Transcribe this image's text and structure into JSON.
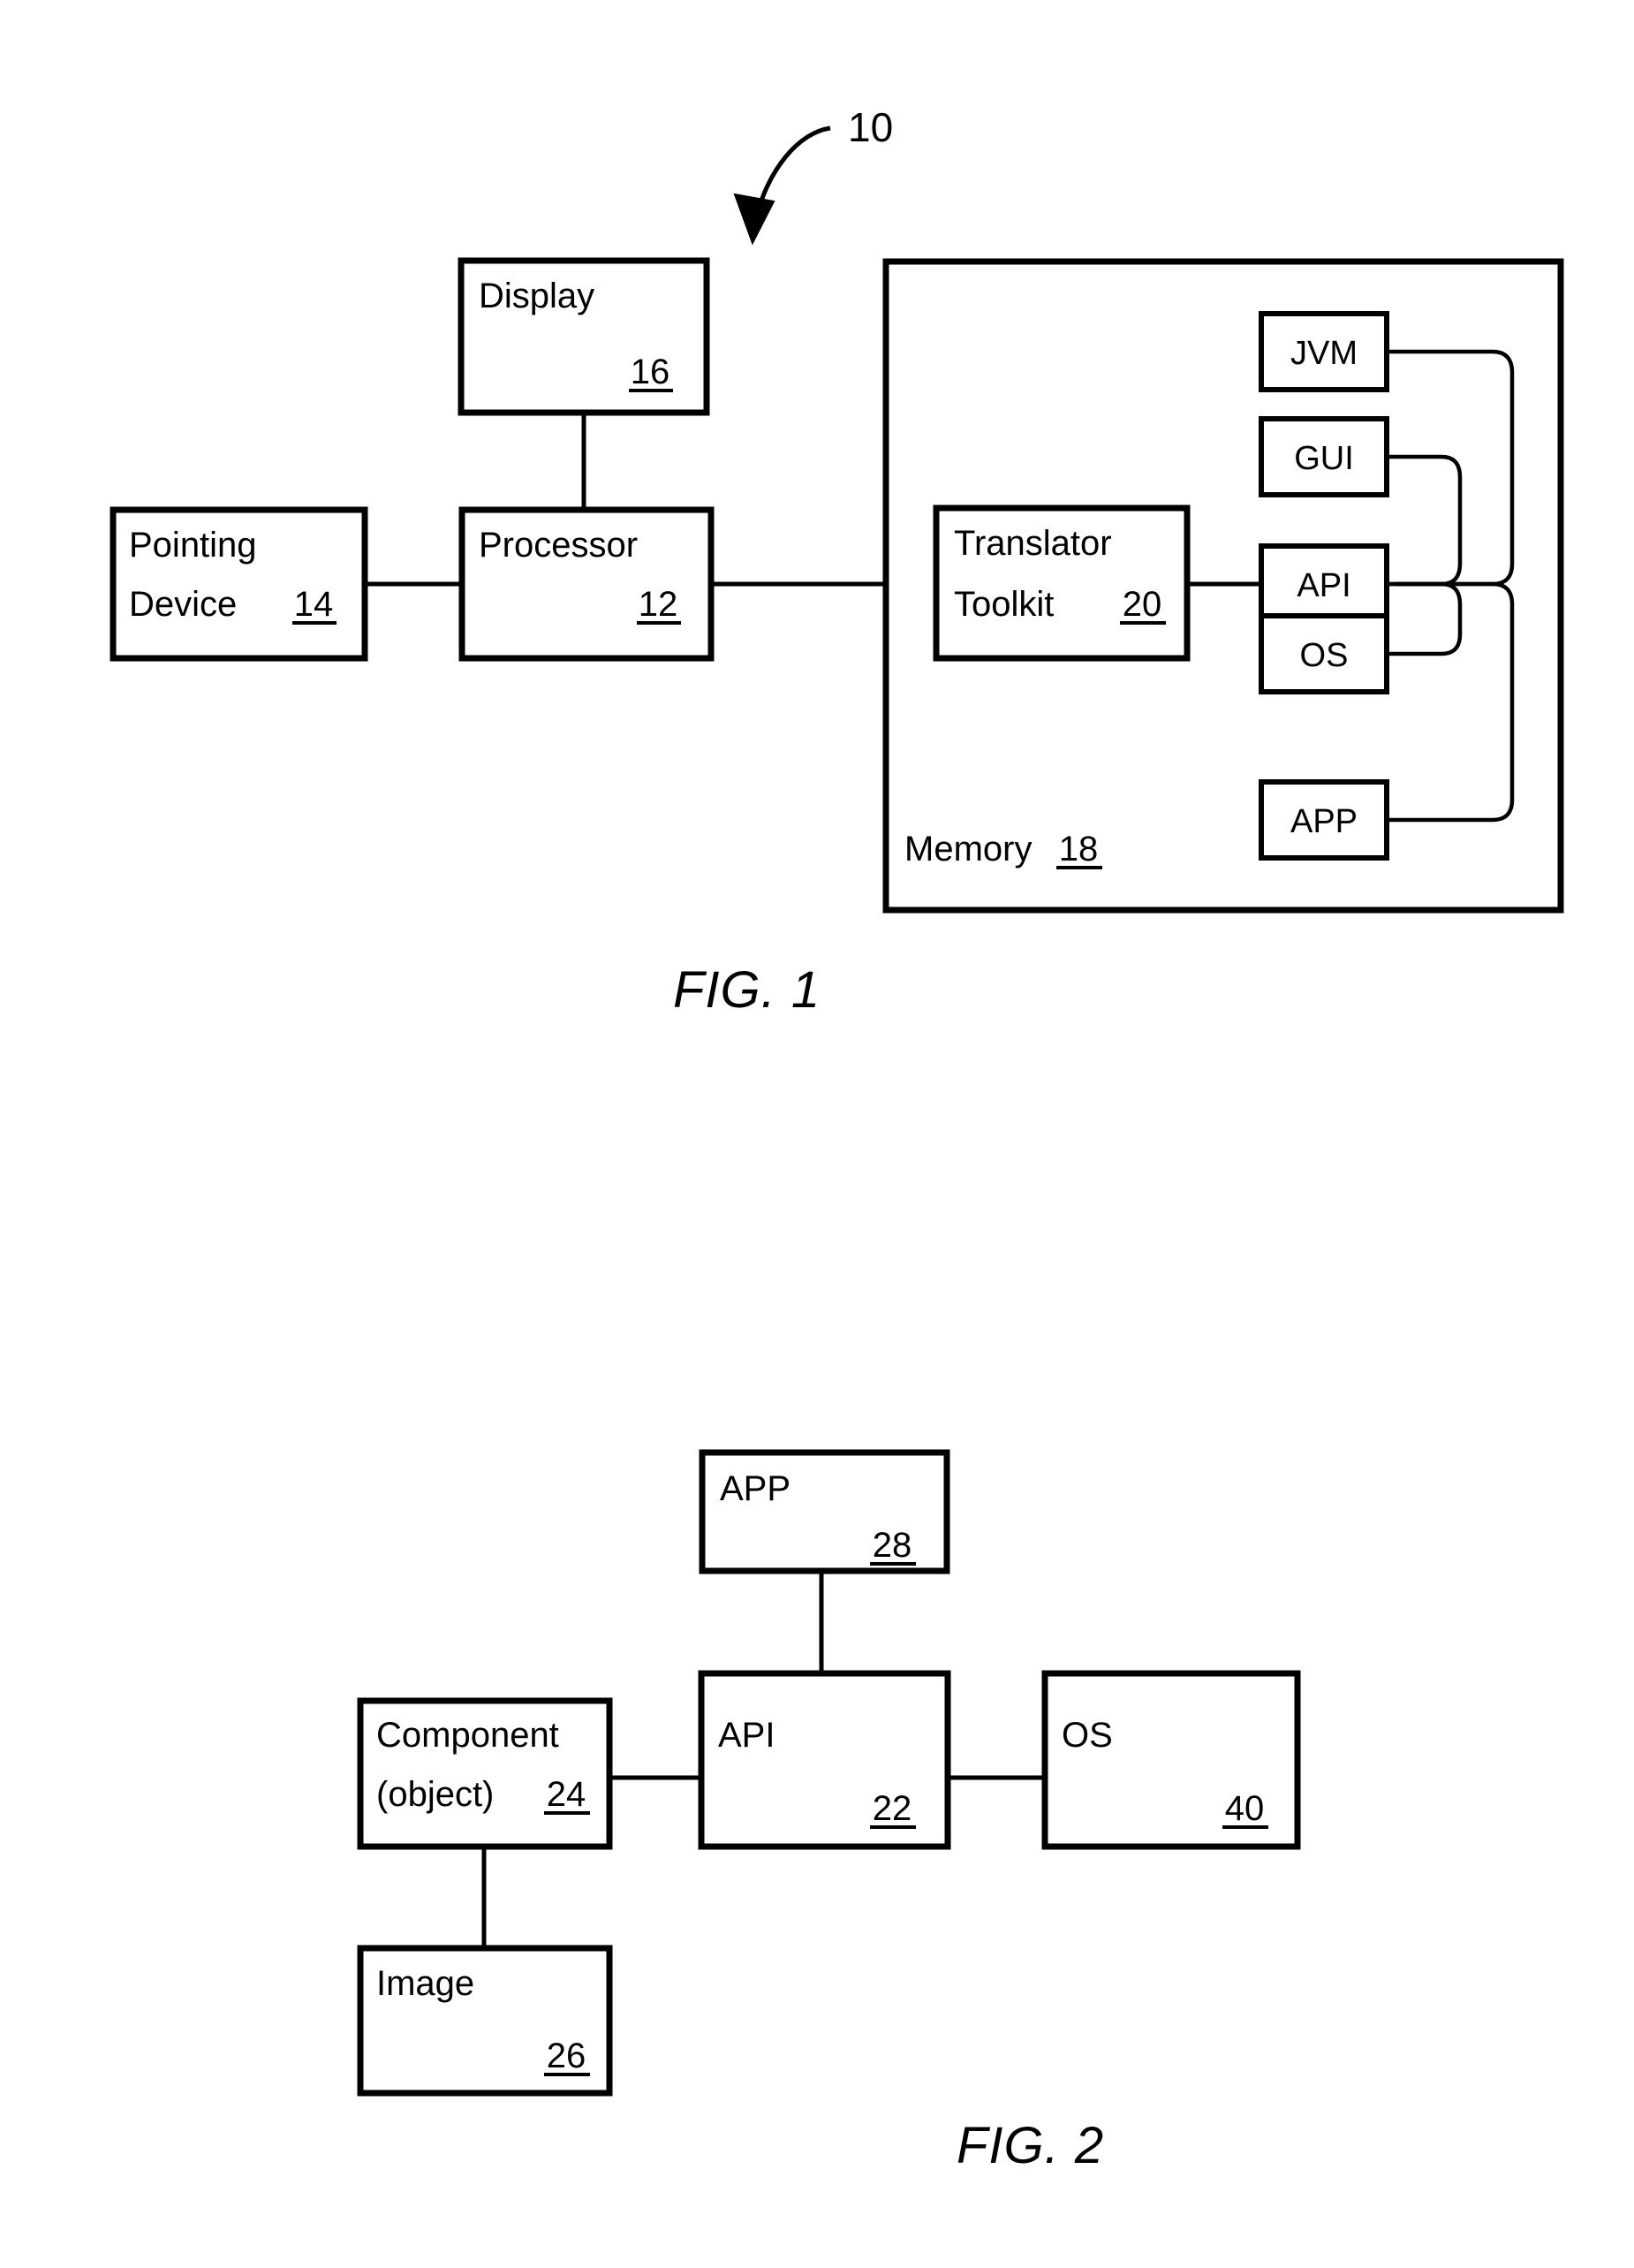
{
  "document": {
    "type": "patent-drawing-sheet",
    "figures": [
      {
        "id": "fig1",
        "caption": "FIG. 1",
        "reference_tag": "10",
        "blocks": [
          {
            "key": "display",
            "label": "Display",
            "number": "16"
          },
          {
            "key": "pointing",
            "label_line1": "Pointing",
            "label_line2": "Device",
            "number": "14"
          },
          {
            "key": "processor",
            "label": "Processor",
            "number": "12"
          },
          {
            "key": "memory",
            "label": "Memory",
            "number": "18"
          },
          {
            "key": "translator",
            "label_line1": "Translator",
            "label_line2": "Toolkit",
            "number": "20"
          },
          {
            "key": "jvm",
            "label": "JVM",
            "number": ""
          },
          {
            "key": "gui",
            "label": "GUI",
            "number": ""
          },
          {
            "key": "api",
            "label": "API",
            "number": ""
          },
          {
            "key": "os",
            "label": "OS",
            "number": ""
          },
          {
            "key": "app",
            "label": "APP",
            "number": ""
          }
        ]
      },
      {
        "id": "fig2",
        "caption": "FIG. 2",
        "blocks": [
          {
            "key": "app2",
            "label": "APP",
            "number": "28"
          },
          {
            "key": "component",
            "label_line1": "Component",
            "label_line2": "(object)",
            "number": "24"
          },
          {
            "key": "api2",
            "label": "API",
            "number": "22"
          },
          {
            "key": "os2",
            "label": "OS",
            "number": "40"
          },
          {
            "key": "image",
            "label": "Image",
            "number": "26"
          }
        ]
      }
    ]
  },
  "fig1": {
    "caption": "FIG. 1",
    "reference_tag": "10",
    "display": {
      "label": "Display",
      "number": "16"
    },
    "pointing_device": {
      "label_line1": "Pointing",
      "label_line2": "Device",
      "number": "14"
    },
    "processor": {
      "label": "Processor",
      "number": "12"
    },
    "memory": {
      "label": "Memory",
      "number": "18"
    },
    "translator_toolkit": {
      "label_line1": "Translator",
      "label_line2": "Toolkit",
      "number": "20"
    },
    "jvm": {
      "label": "JVM"
    },
    "gui": {
      "label": "GUI"
    },
    "api": {
      "label": "API"
    },
    "os": {
      "label": "OS"
    },
    "app": {
      "label": "APP"
    }
  },
  "fig2": {
    "caption": "FIG. 2",
    "app": {
      "label": "APP",
      "number": "28"
    },
    "component": {
      "label_line1": "Component",
      "label_line2": "(object)",
      "number": "24"
    },
    "api": {
      "label": "API",
      "number": "22"
    },
    "os": {
      "label": "OS",
      "number": "40"
    },
    "image": {
      "label": "Image",
      "number": "26"
    }
  },
  "colors": {
    "ink": "#000000",
    "paper": "#ffffff"
  }
}
